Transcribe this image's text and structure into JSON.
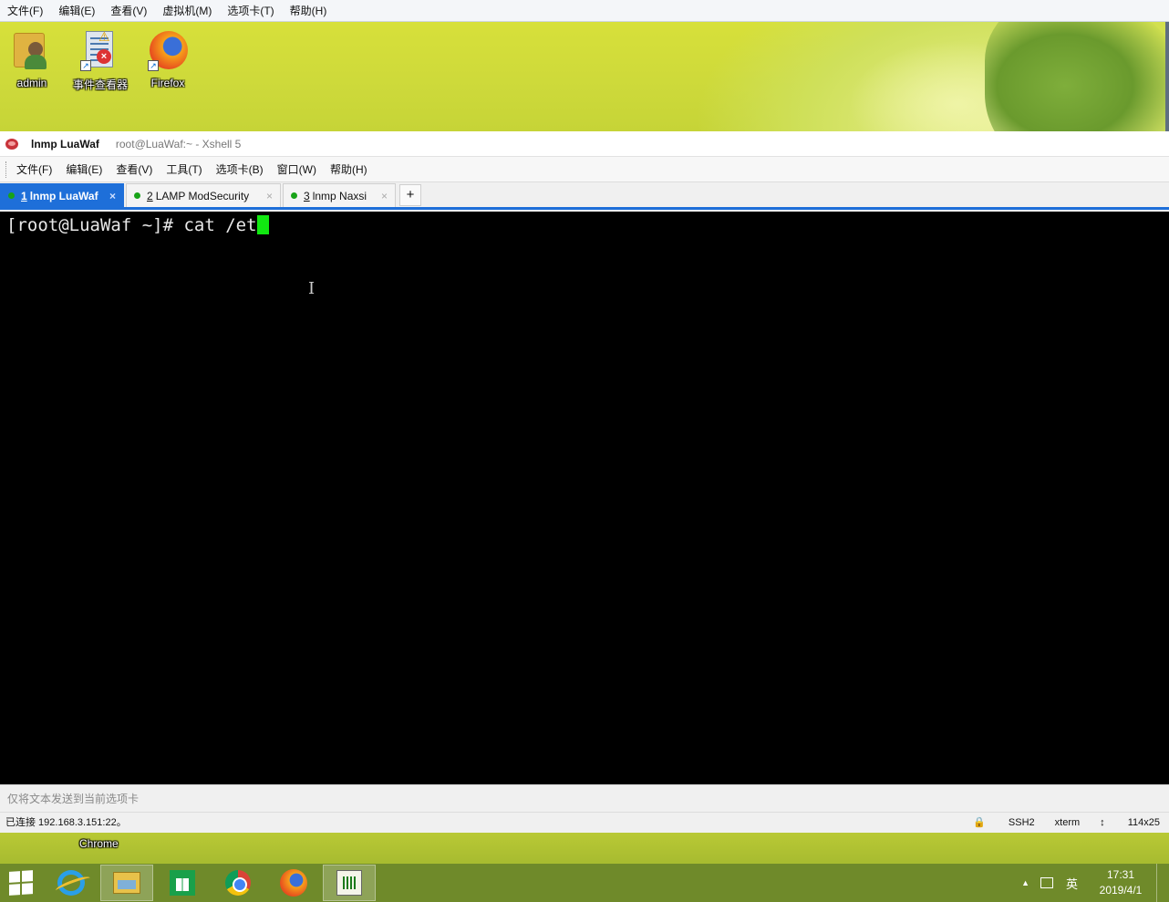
{
  "host_menu": [
    "文件(F)",
    "编辑(E)",
    "查看(V)",
    "虚拟机(M)",
    "选项卡(T)",
    "帮助(H)"
  ],
  "desktop": {
    "icons": [
      {
        "label": "admin",
        "icon": "user-folder-icon"
      },
      {
        "label": "事件查看器",
        "icon": "event-viewer-icon"
      },
      {
        "label": "Firefox",
        "icon": "firefox-icon"
      }
    ],
    "lower_icon_label": "Chrome"
  },
  "xshell": {
    "title": "lnmp LuaWaf",
    "subtitle": "root@LuaWaf:~ - Xshell 5",
    "menu": [
      "文件(F)",
      "编辑(E)",
      "查看(V)",
      "工具(T)",
      "选项卡(B)",
      "窗口(W)",
      "帮助(H)"
    ],
    "tabs": [
      {
        "num": "1",
        "label": "lnmp LuaWaf",
        "active": true
      },
      {
        "num": "2",
        "label": "LAMP ModSecurity",
        "active": false
      },
      {
        "num": "3",
        "label": "lnmp Naxsi",
        "active": false
      }
    ],
    "add_tab": "+",
    "tab_close": "×",
    "terminal": {
      "prompt": "[root@LuaWaf ~]# ",
      "input": "cat /et"
    },
    "send_bar_text": "仅将文本发送到当前选项卡",
    "status": {
      "connection": "已连接 192.168.3.151:22。",
      "protocol": "SSH2",
      "terminal_type": "xterm",
      "size": "114x25"
    }
  },
  "taskbar": {
    "apps": [
      "start-button",
      "internet-explorer",
      "file-explorer",
      "store",
      "chrome",
      "firefox",
      "notepad-app"
    ],
    "tray": {
      "ime": "英",
      "time": "17:31",
      "date": "2019/4/1"
    }
  },
  "colors": {
    "tab_active": "#1e6fd9",
    "cursor": "#11e811",
    "taskbar": "#6f8a2a"
  }
}
